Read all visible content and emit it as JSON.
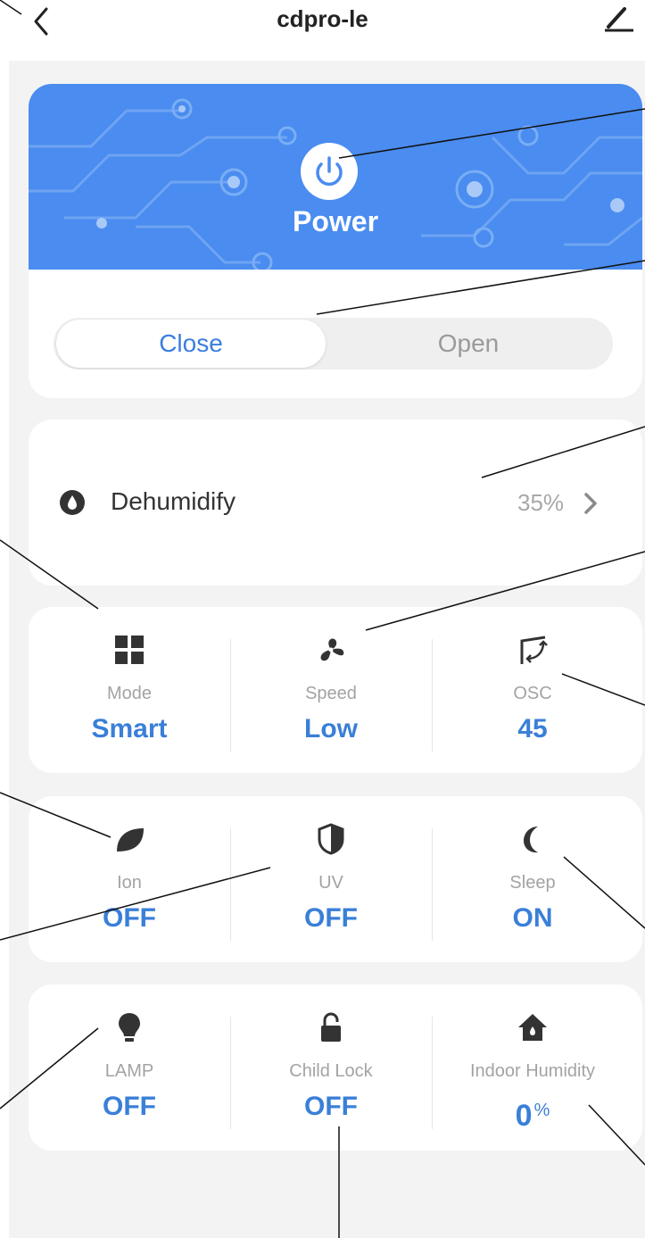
{
  "header": {
    "title": "cdpro-le",
    "back_icon": "chevron-left-icon",
    "edit_icon": "pencil-icon"
  },
  "power": {
    "label": "Power",
    "icon": "power-icon",
    "accent": "#4a8cef"
  },
  "switch": {
    "close_label": "Close",
    "open_label": "Open",
    "selected": "Close"
  },
  "dehumidify": {
    "label": "Dehumidify",
    "value": "35%",
    "icon": "water-drop-icon"
  },
  "controls": [
    [
      {
        "label": "Mode",
        "value": "Smart",
        "icon": "grid-icon"
      },
      {
        "label": "Speed",
        "value": "Low",
        "icon": "fan-icon"
      },
      {
        "label": "OSC",
        "value": "45",
        "icon": "oscillate-icon"
      }
    ],
    [
      {
        "label": "Ion",
        "value": "OFF",
        "icon": "leaf-icon"
      },
      {
        "label": "UV",
        "value": "OFF",
        "icon": "shield-icon"
      },
      {
        "label": "Sleep",
        "value": "ON",
        "icon": "moon-icon"
      }
    ],
    [
      {
        "label": "LAMP",
        "value": "OFF",
        "icon": "bulb-icon"
      },
      {
        "label": "Child Lock",
        "value": "OFF",
        "icon": "lock-icon"
      },
      {
        "label": "Indoor Humidity",
        "value": "0",
        "unit": "%",
        "icon": "home-icon"
      }
    ]
  ],
  "colors": {
    "value_blue": "#3a7fd8",
    "label_gray": "#a3a3a3",
    "background": "#f3f3f3"
  }
}
